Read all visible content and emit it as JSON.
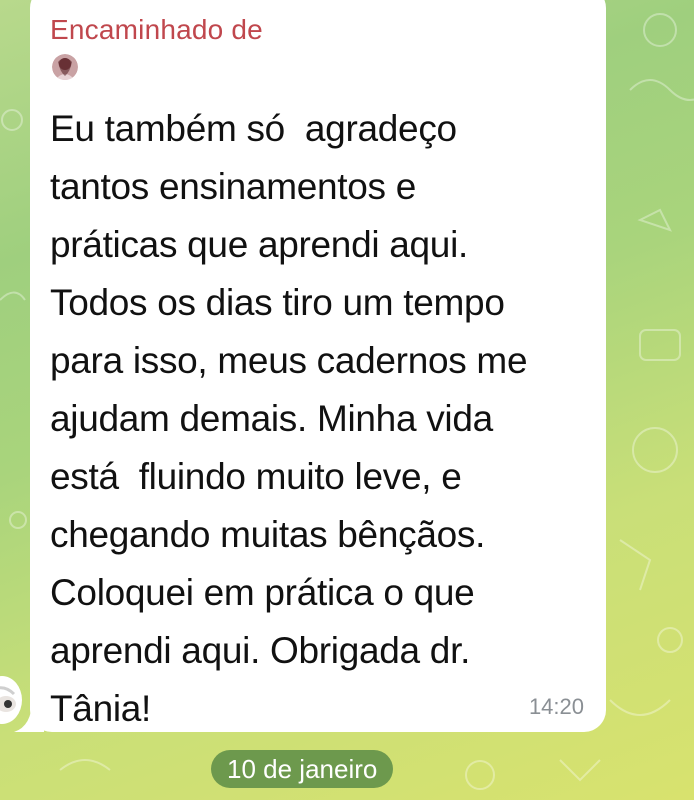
{
  "colors": {
    "forward_label": "#c0474d",
    "bubble": "#ffffff",
    "text": "#111111",
    "timestamp": "#8a8f94",
    "date_pill": "#5c8c46"
  },
  "message": {
    "forwarded_label": "Encaminhado de",
    "sender_avatar_icon": "profile-photo-icon",
    "text": "Eu também só  agradeço\ntantos ensinamentos e\npráticas que aprendi aqui.\nTodos os dias tiro um tempo\npara isso, meus cadernos me\najudam demais. Minha vida\nestá  fluindo muito leve, e\nchegando muitas bênçãos.\nColoquei em prática o que\naprendi aqui. Obrigada dr.\nTânia!",
    "time": "14:20"
  },
  "date_separator": {
    "label": "10 de janeiro"
  }
}
